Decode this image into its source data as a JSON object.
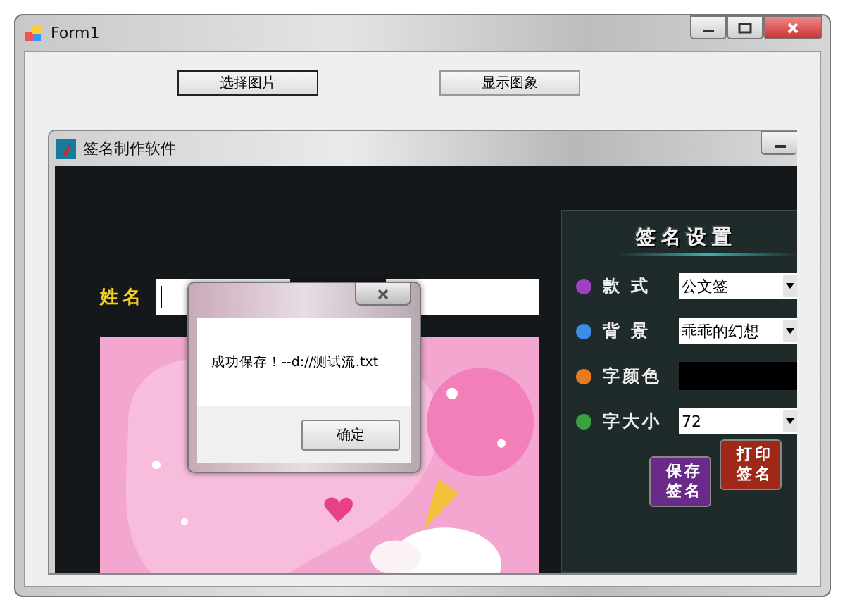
{
  "window": {
    "title": "Form1"
  },
  "buttons": [
    {
      "label": "选择图片",
      "focused": true
    },
    {
      "label": "显示图象",
      "focused": false
    }
  ],
  "inner_window": {
    "title": "签名制作软件",
    "name_label": "姓名",
    "name_field": {
      "focused": true
    },
    "settings": {
      "title": "签名设置",
      "rows": [
        {
          "label": "款 式",
          "kind": "dropdown",
          "value": "公文签",
          "color": "#a040c0"
        },
        {
          "label": "背 景",
          "kind": "dropdown",
          "value": "乖乖的幻想",
          "color": "#3a8ee8"
        },
        {
          "label": "字颜色",
          "kind": "swatch",
          "color": "#e87a20"
        },
        {
          "label": "字大小",
          "kind": "dropdown",
          "value": "72",
          "color": "#3aa040"
        }
      ],
      "buttons": [
        {
          "label": "保存签名",
          "color": "#6a2a8a"
        },
        {
          "label": "打印签名",
          "color": "#a02818"
        }
      ]
    }
  },
  "dialog": {
    "message": "成功保存！--d://测试流.txt",
    "buttons": [
      "确定"
    ]
  }
}
